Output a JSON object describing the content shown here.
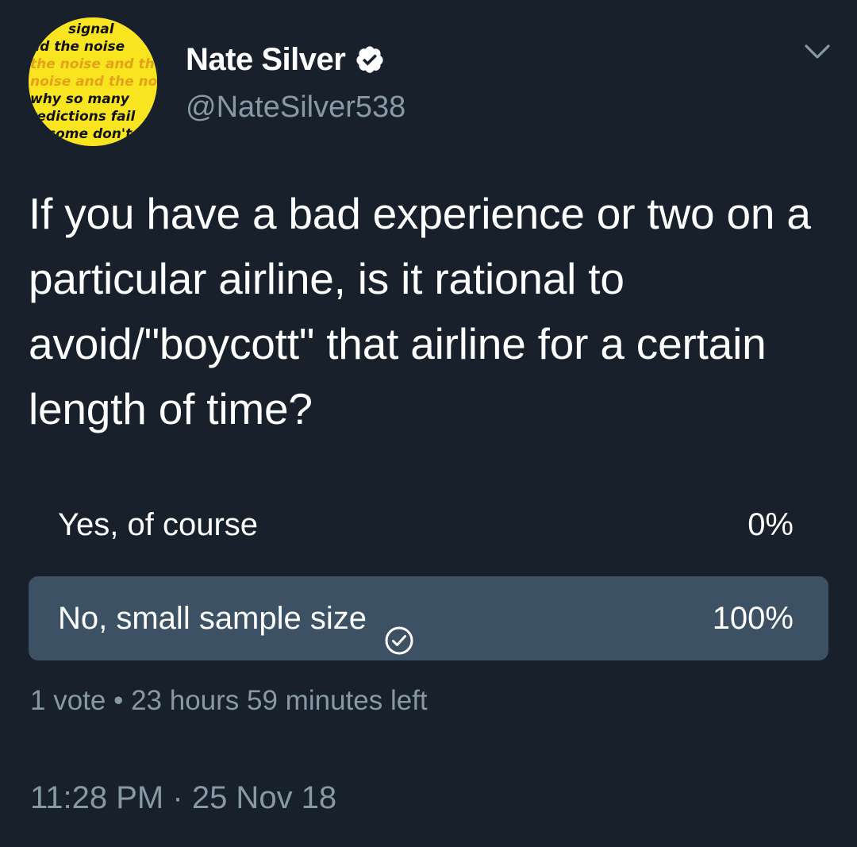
{
  "author": {
    "display_name": "Nate Silver",
    "handle": "@NateSilver538",
    "verified": true,
    "avatar_lines": [
      "signal",
      "nd the noise",
      "the noise and th",
      "noise and the no",
      "why so many",
      "redictions fail",
      "some don't"
    ]
  },
  "tweet": {
    "text": "If you have a bad experience or two on a particular airline, is it rational to avoid/\"boycott\" that airline for a certain length of time?"
  },
  "poll": {
    "options": [
      {
        "label": "Yes, of course",
        "percent_label": "0%",
        "share": 0.0,
        "selected": false
      },
      {
        "label": "No, small sample size",
        "percent_label": "100%",
        "share": 1.0,
        "selected": true
      }
    ],
    "votes": "1 vote",
    "separator": "•",
    "time_left": "23 hours 59 minutes left"
  },
  "timestamp": {
    "time": "11:28 PM",
    "separator": "·",
    "date": "25 Nov 18"
  },
  "colors": {
    "background": "#17202b",
    "secondary_text": "#8899a6",
    "poll_bar": "#3c5163",
    "avatar_bg": "#f8e51f"
  }
}
